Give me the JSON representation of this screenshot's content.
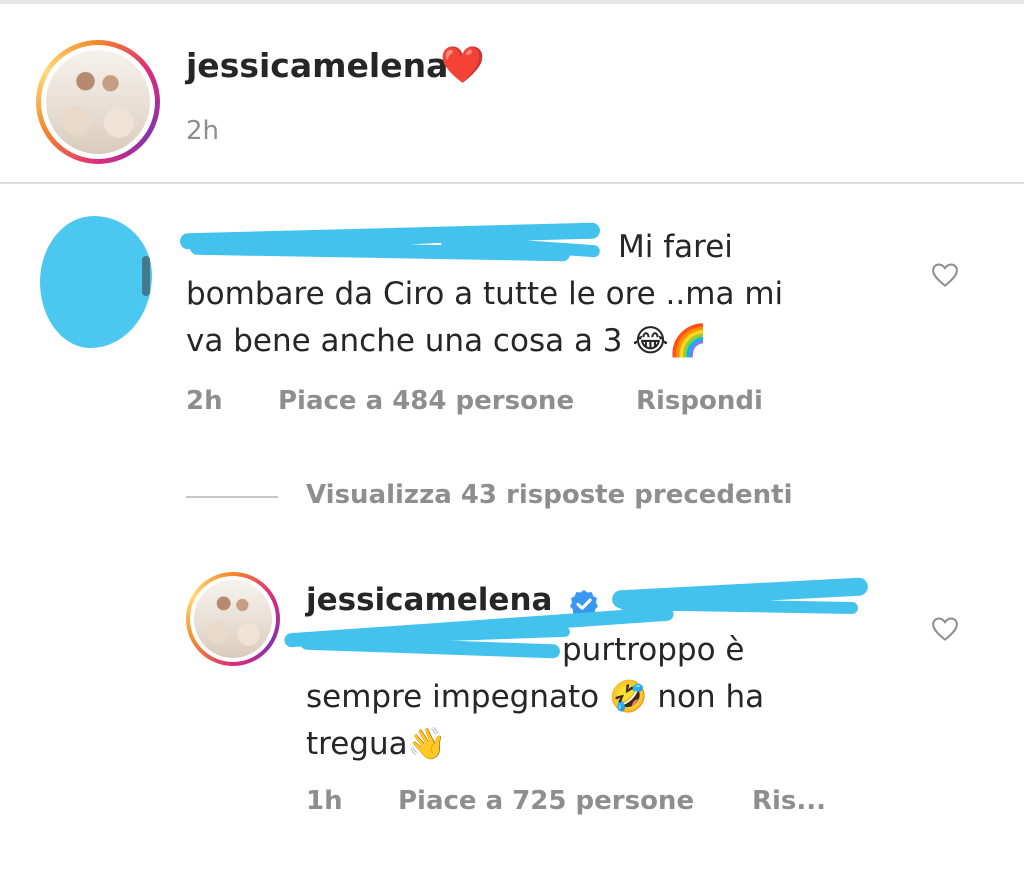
{
  "post": {
    "username": "jessicamelena",
    "heart_emoji": "❤️",
    "time": "2h"
  },
  "comment": {
    "text_line1": "Mi farei",
    "text_line2": "bombare da Ciro a tutte le ore ..ma mi",
    "text_line3": "va bene anche una cosa a 3 😂🌈",
    "time": "2h",
    "likes": "Piace a 484 persone",
    "reply_label": "Rispondi"
  },
  "view_replies": "Visualizza 43 risposte precedenti",
  "reply": {
    "username": "jessicamelena",
    "text_line2": "purtroppo è",
    "text_line3": "sempre impegnato 🤣 non ha",
    "text_line4": "tregua👋",
    "time": "1h",
    "likes": "Piace a 725 persone",
    "reply_label": "Ris..."
  },
  "colors": {
    "text": "#262626",
    "secondary": "#8e8e8e",
    "verified": "#3897f0",
    "redaction": "#44c2ee"
  }
}
